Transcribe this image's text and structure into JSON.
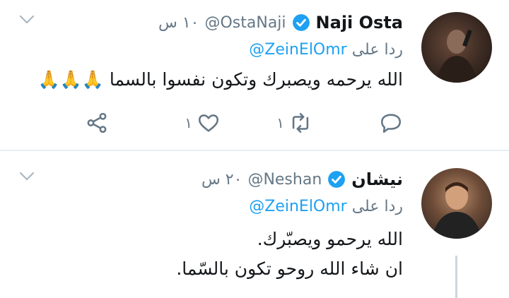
{
  "tweets": [
    {
      "name": "Naji Osta",
      "handle": "@OstaNaji",
      "time": "١٠ س",
      "reply_prefix": "ردا على",
      "reply_mention": "@ZeinElOmr",
      "text": "الله يرحمه ويصبرك وتكون نفسوا بالسما 🙏🙏🙏",
      "retweet_count": "١",
      "like_count": "١"
    },
    {
      "name": "نيشان",
      "handle": "@Neshan",
      "time": "٢٠ س",
      "reply_prefix": "ردا على",
      "reply_mention": "@ZeinElOmr",
      "text_line1": "الله يرحمو ويصبّرك.",
      "text_line2": "ان شاء الله روحو تكون بالسّما."
    }
  ],
  "colors": {
    "accent": "#1da1f2",
    "secondary": "#657786",
    "divider": "#e6ecf0"
  },
  "icons": [
    "verified-icon",
    "chevron-down-icon",
    "reply-icon",
    "retweet-icon",
    "like-icon",
    "share-icon"
  ]
}
